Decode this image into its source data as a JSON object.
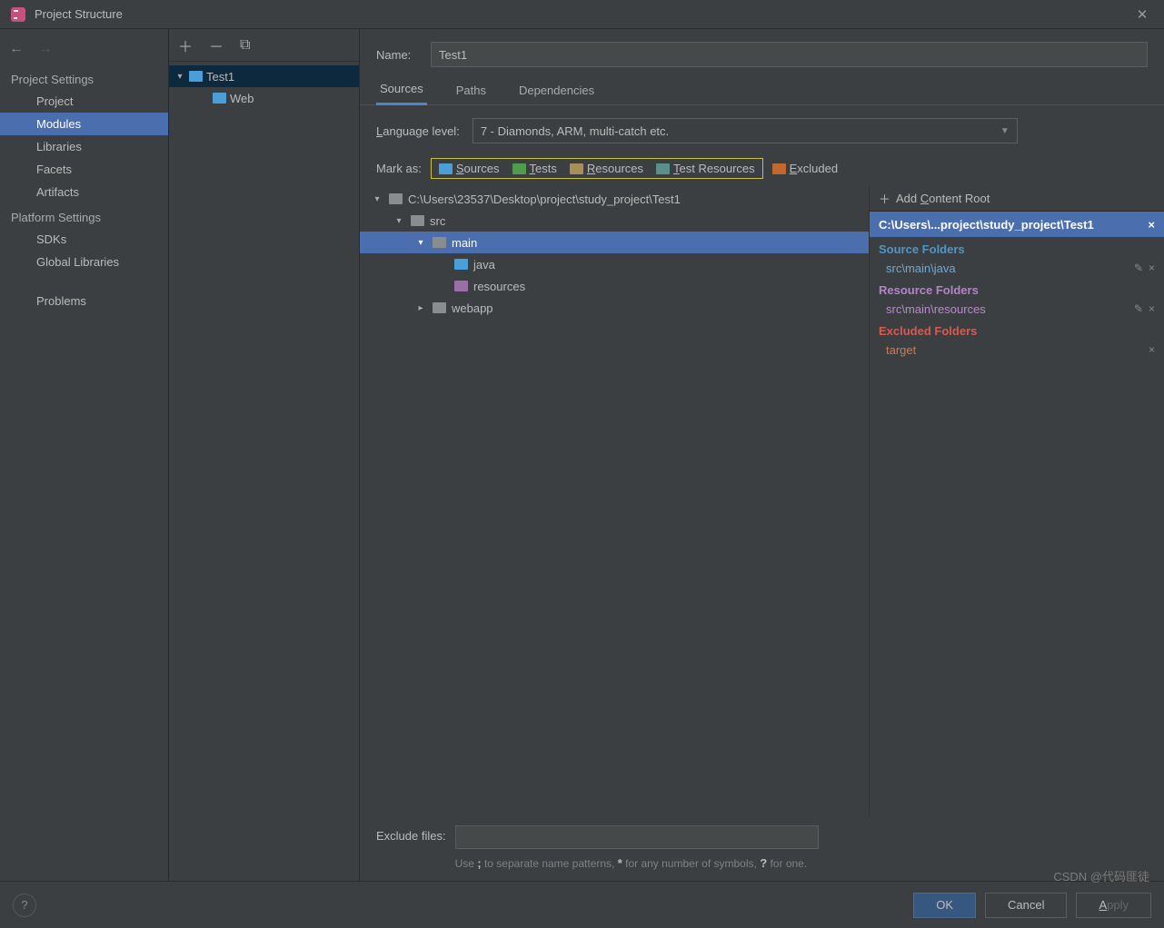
{
  "window": {
    "title": "Project Structure"
  },
  "nav": {
    "groups": [
      {
        "label": "Project Settings",
        "items": [
          "Project",
          "Modules",
          "Libraries",
          "Facets",
          "Artifacts"
        ],
        "selected": "Modules"
      },
      {
        "label": "Platform Settings",
        "items": [
          "SDKs",
          "Global Libraries"
        ]
      }
    ],
    "extra": "Problems"
  },
  "modules": {
    "root": {
      "name": "Test1",
      "expanded": true
    },
    "children": [
      {
        "name": "Web",
        "type": "facet"
      }
    ]
  },
  "detail": {
    "name_label": "Name:",
    "name_value": "Test1",
    "tabs": [
      "Sources",
      "Paths",
      "Dependencies"
    ],
    "active_tab": "Sources",
    "lang_label_prefix": "L",
    "lang_label_rest": "anguage level:",
    "lang_value": "7 - Diamonds, ARM, multi-catch etc.",
    "mark_label": "Mark as:",
    "mark_items": [
      {
        "label": "Sources",
        "u": "S",
        "rest": "ources",
        "color": "ic-blue"
      },
      {
        "label": "Tests",
        "u": "T",
        "rest": "ests",
        "color": "ic-green"
      },
      {
        "label": "Resources",
        "u": "R",
        "rest": "esources",
        "color": "ic-gold"
      },
      {
        "label": "Test Resources",
        "u": "T",
        "rest": "est Resources",
        "color": "ic-teal"
      },
      {
        "label": "Excluded",
        "u": "E",
        "rest": "xcluded",
        "color": "ic-orange"
      }
    ],
    "tree": [
      {
        "depth": 0,
        "chev": "down",
        "icon": "ic-grey",
        "label": "C:\\Users\\23537\\Desktop\\project\\study_project\\Test1"
      },
      {
        "depth": 1,
        "chev": "down",
        "icon": "ic-grey",
        "label": "src"
      },
      {
        "depth": 2,
        "chev": "down",
        "icon": "ic-grey",
        "label": "main",
        "selected": true
      },
      {
        "depth": 3,
        "chev": "",
        "icon": "ic-blue",
        "label": "java"
      },
      {
        "depth": 3,
        "chev": "",
        "icon": "ic-purple",
        "label": "resources"
      },
      {
        "depth": 2,
        "chev": "right",
        "icon": "ic-grey",
        "label": "webapp"
      }
    ],
    "add_root_label": "Add Content Root",
    "root_path": "C:\\Users\\...project\\study_project\\Test1",
    "sections": [
      {
        "title": "Source Folders",
        "cls": "sect-src",
        "items": [
          {
            "path": "src\\main\\java",
            "cls": "c-src",
            "edit": true
          }
        ]
      },
      {
        "title": "Resource Folders",
        "cls": "sect-res",
        "items": [
          {
            "path": "src\\main\\resources",
            "cls": "c-res",
            "edit": true
          }
        ]
      },
      {
        "title": "Excluded Folders",
        "cls": "sect-exc",
        "items": [
          {
            "path": "target",
            "cls": "c-exc",
            "edit": false
          }
        ]
      }
    ],
    "exclude_label": "Exclude files:",
    "exclude_hint": "Use ; to separate name patterns, * for any number of symbols, ? for one."
  },
  "footer": {
    "ok": "OK",
    "cancel": "Cancel",
    "apply": "Apply"
  },
  "watermark": "CSDN @代码匪徒"
}
